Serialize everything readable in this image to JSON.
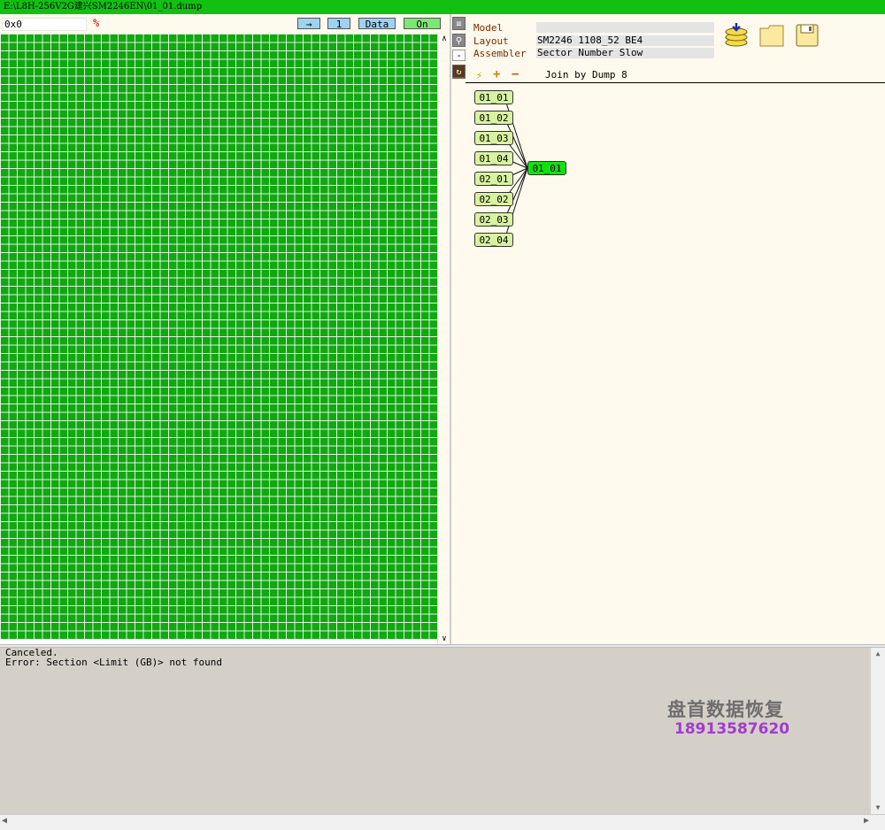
{
  "window": {
    "title": "E:\\L8H-256V2G建兴SM2246EN\\01_01.dump"
  },
  "toolbar": {
    "address": "0x0",
    "percent_icon": "percent-icon",
    "arrow_label": "→",
    "one_label": "1",
    "data_label": "Data",
    "on_label": "On"
  },
  "grid": {
    "cell_color": "#11a811",
    "line_color": "#ffffff"
  },
  "scroll": {
    "up": "∧",
    "down": "∨"
  },
  "right": {
    "side_icons": [
      "list-icon",
      "pin-icon",
      "pin-icon",
      "rotate-icon"
    ],
    "minus_label": "-",
    "model_label": "Model",
    "model_value": "",
    "layout_label": "Layout",
    "layout_value": "SM2246 1108_52 BE4",
    "assembler_label": "Assembler",
    "assembler_value": "Sector Number Slow",
    "icons": [
      "database-icon",
      "folder-icon",
      "save-icon"
    ],
    "bolt": "⚡",
    "plus": "+",
    "minus": "−",
    "join_label": "Join by Dump 8",
    "nodes": [
      "01_01",
      "01_02",
      "01_03",
      "01_04",
      "02_01",
      "02_02",
      "02_03",
      "02_04"
    ],
    "root_node": "01_01"
  },
  "log": {
    "lines": [
      "Canceled.",
      "Error: Section <Limit (GB)> not found"
    ]
  },
  "watermark": {
    "name": "盘首数据恢复",
    "phone": "18913587620"
  },
  "colors": {
    "title_bar": "#11c111",
    "grid_green": "#11a811",
    "root_node": "#11e011",
    "node": "#d8f3a0",
    "pane_bg": "#fffaed",
    "log_bg": "#d4d0c8"
  }
}
